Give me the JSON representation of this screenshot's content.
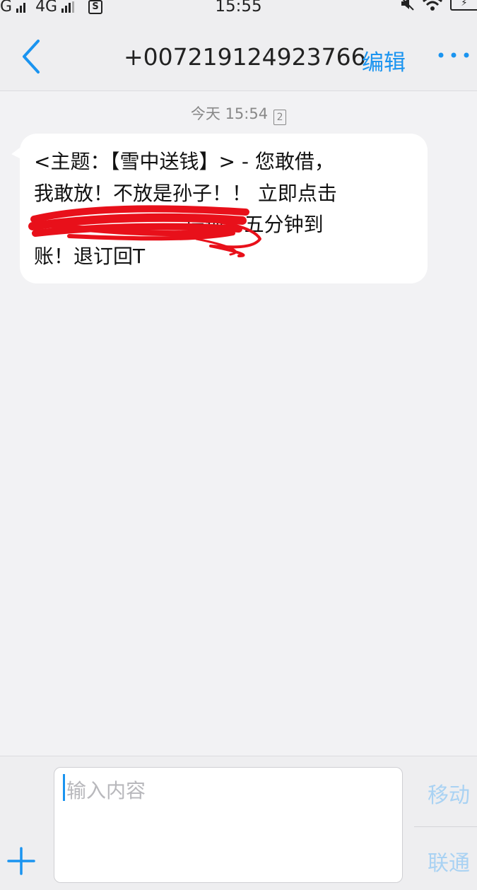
{
  "status_bar": {
    "left": "G",
    "network": "4G",
    "sim_label": "S",
    "time": "15:55",
    "battery_symbol": "⚡"
  },
  "header": {
    "title": "+007219124923766",
    "edit_label": "编辑"
  },
  "conversation": {
    "timestamp": "今天 15:54",
    "sim_indicator": "2",
    "message_text": "<主题：【雪中送钱】> - 您敢借，\n我敢放！不放是孙子！！ 立即点击\n                        提现！五分钟到\n账！退订回T"
  },
  "composer": {
    "placeholder": "输入内容",
    "carriers": [
      "移动",
      "联通"
    ]
  },
  "colors": {
    "accent": "#1a94f0",
    "redaction": "#e8101a",
    "bubble": "#ffffff",
    "background": "#f2f2f4"
  }
}
